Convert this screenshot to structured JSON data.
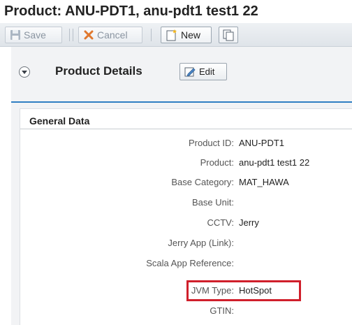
{
  "page": {
    "title": "Product: ANU-PDT1, anu-pdt1 test1 22"
  },
  "toolbar": {
    "save_label": "Save",
    "cancel_label": "Cancel",
    "new_label": "New"
  },
  "section": {
    "title": "Product Details",
    "edit_label": "Edit"
  },
  "general": {
    "title": "General Data",
    "fields": [
      {
        "label": "Product ID:",
        "value": "ANU-PDT1"
      },
      {
        "label": "Product:",
        "value": "anu-pdt1 test1 22"
      },
      {
        "label": "Base Category:",
        "value": "MAT_HAWA"
      },
      {
        "label": "Base Unit:",
        "value": ""
      },
      {
        "label": "CCTV:",
        "value": "Jerry"
      },
      {
        "label": "Jerry App (Link):",
        "value": ""
      },
      {
        "label": "Scala App Reference:",
        "value": ""
      },
      {
        "label": "JVM Type:",
        "value": "HotSpot"
      },
      {
        "label": "GTIN:",
        "value": ""
      }
    ]
  },
  "colors": {
    "accent": "#2f7ec2",
    "highlight": "#d01f2b"
  }
}
